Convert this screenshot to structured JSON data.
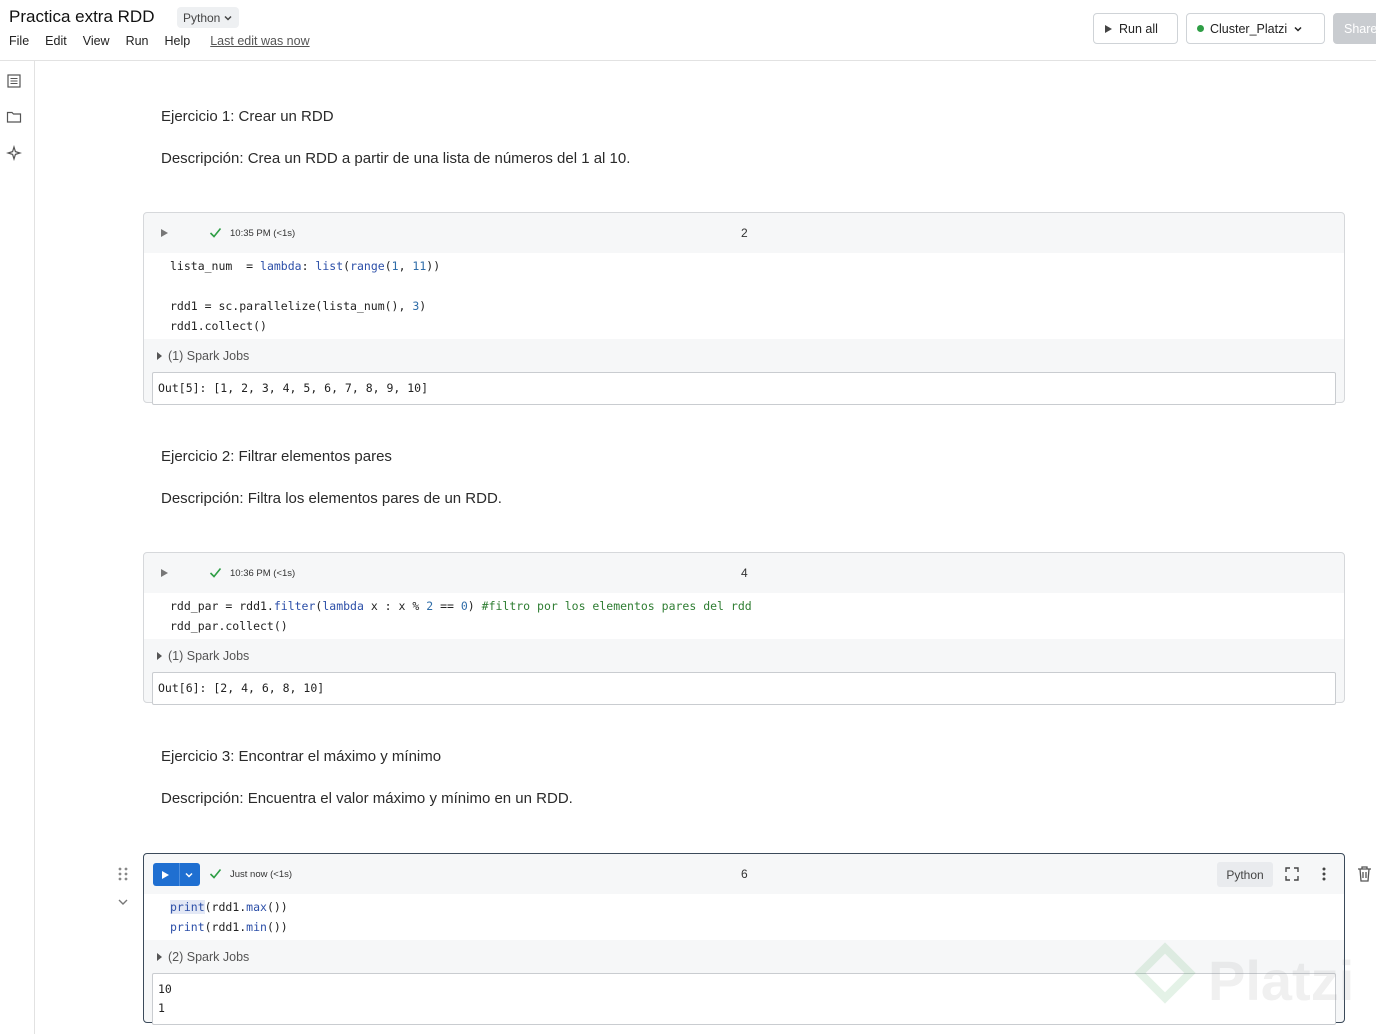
{
  "header": {
    "title": "Practica extra RDD",
    "language": "Python",
    "menu": [
      "File",
      "Edit",
      "View",
      "Run",
      "Help"
    ],
    "last_edit": "Last edit was now",
    "run_all": "Run all",
    "cluster": "Cluster_Platzi",
    "share": "Share"
  },
  "markdown": {
    "ex1_title": "Ejercicio 1: Crear un RDD",
    "ex1_desc": "Descripción: Crea un RDD a partir de una lista de números del 1 al 10.",
    "ex2_title": "Ejercicio 2: Filtrar elementos pares",
    "ex2_desc": "Descripción: Filtra los elementos pares de un RDD.",
    "ex3_title": "Ejercicio 3: Encontrar el máximo y mínimo",
    "ex3_desc": "Descripción: Encuentra el valor máximo y mínimo en un RDD."
  },
  "cells": [
    {
      "timestamp": "10:35 PM (<1s)",
      "number": "2",
      "spark_jobs": "(1) Spark Jobs",
      "output": "Out[5]: [1, 2, 3, 4, 5, 6, 7, 8, 9, 10]"
    },
    {
      "timestamp": "10:36 PM (<1s)",
      "number": "4",
      "spark_jobs": "(1) Spark Jobs",
      "output": "Out[6]: [2, 4, 6, 8, 10]"
    },
    {
      "timestamp": "Just now (<1s)",
      "number": "6",
      "language": "Python",
      "spark_jobs": "(2) Spark Jobs",
      "output_line1": "10",
      "output_line2": "1"
    }
  ],
  "watermark": "Platzi",
  "colors": {
    "accent_blue": "#1f6fd1",
    "status_green": "#2e9e45",
    "keyword": "#2c4fa8",
    "comment": "#2e7d32"
  }
}
